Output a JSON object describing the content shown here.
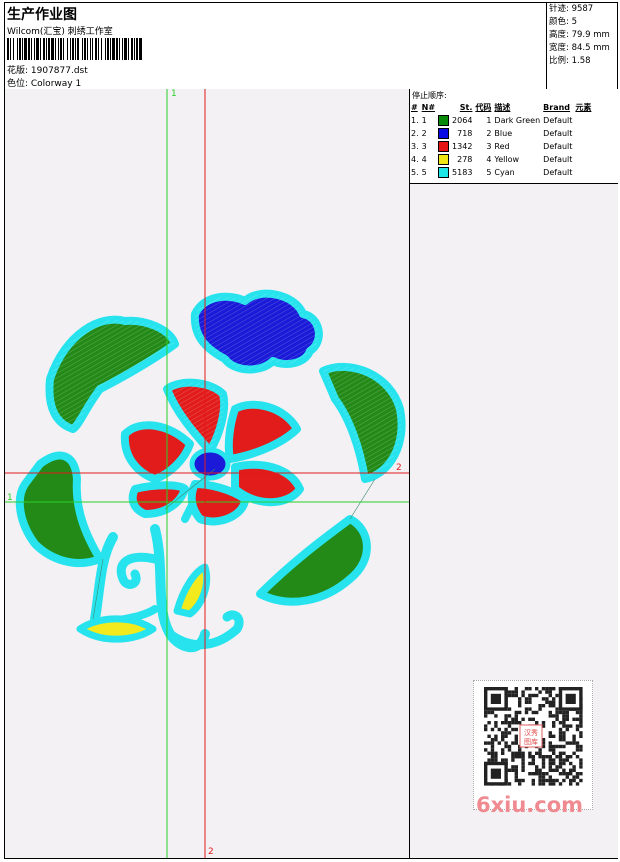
{
  "header": {
    "title": "生产作业图",
    "subtitle": "Wilcom(汇宝) 刺绣工作室",
    "design_label": "花版: 1907877.dst",
    "colorway_label": "色位: Colorway 1"
  },
  "stats": [
    {
      "label": "针迹:",
      "value": "9587"
    },
    {
      "label": "颜色:",
      "value": "5"
    },
    {
      "label": "高度:",
      "value": "79.9 mm"
    },
    {
      "label": "宽度:",
      "value": "84.5 mm"
    },
    {
      "label": "比例:",
      "value": "1.58"
    }
  ],
  "stop_sequence": {
    "title": "停止顺序:",
    "columns": [
      "#",
      "N#",
      "St.",
      "代码",
      "描述",
      "Brand",
      "元素"
    ],
    "rows": [
      {
        "idx": "1.",
        "n": "1",
        "color": "#0a8a0a",
        "st": "2064",
        "code": "1",
        "desc": "Dark Green",
        "brand": "Default"
      },
      {
        "idx": "2.",
        "n": "2",
        "color": "#0a0ae6",
        "st": "718",
        "code": "2",
        "desc": "Blue",
        "brand": "Default"
      },
      {
        "idx": "3.",
        "n": "3",
        "color": "#e61414",
        "st": "1342",
        "code": "3",
        "desc": "Red",
        "brand": "Default"
      },
      {
        "idx": "4.",
        "n": "4",
        "color": "#f0e614",
        "st": "278",
        "code": "4",
        "desc": "Yellow",
        "brand": "Default"
      },
      {
        "idx": "5.",
        "n": "5",
        "color": "#1ee6e6",
        "st": "5183",
        "code": "5",
        "desc": "Cyan",
        "brand": "Default"
      }
    ]
  },
  "axis_labels": {
    "green_v": "1",
    "green_h": "1",
    "red_h": "2",
    "red_v": "2"
  },
  "watermark": "6xiu.com",
  "qr_stamp": "汉秀图库"
}
